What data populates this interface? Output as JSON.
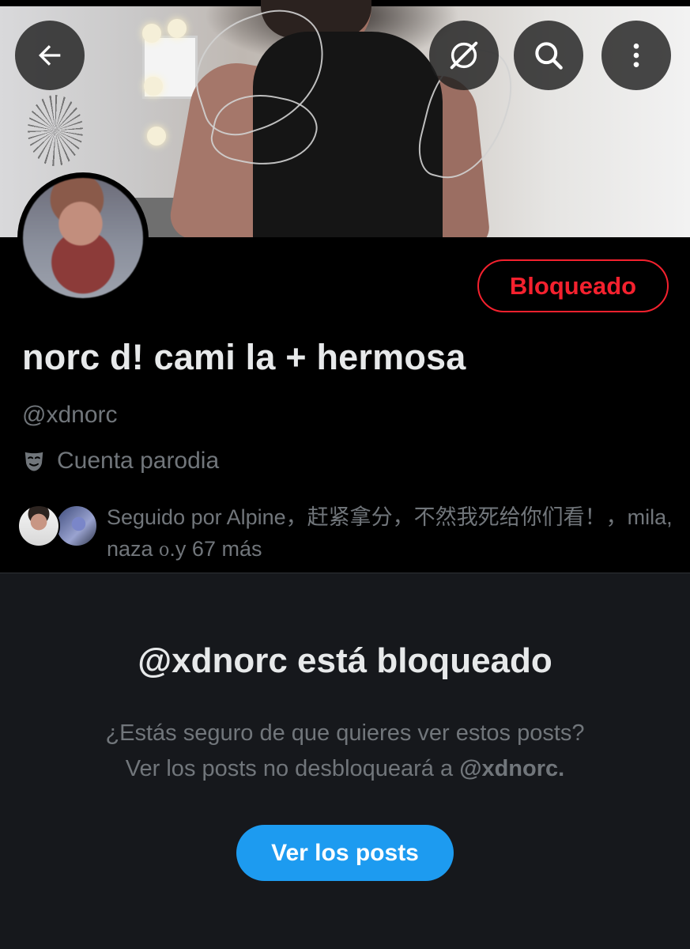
{
  "header": {
    "back_icon": "arrow-left-icon",
    "grok_icon": "grok-icon",
    "search_icon": "search-icon",
    "more_icon": "vertical-ellipsis-icon"
  },
  "profile": {
    "display_name": "norc d! cami la + hermosa",
    "handle": "@xdnorc",
    "parody_label": "Cuenta parodia",
    "parody_icon": "theater-mask-icon",
    "blocked_button_label": "Bloqueado",
    "followers_text": "Seguido por Alpine，赶紧拿分，不然我死给你们看！，mila, naza ᦞ.y 67 más"
  },
  "blocked_notice": {
    "title": "@xdnorc está bloqueado",
    "line1": "¿Estás seguro de que quieres ver estos posts?",
    "line2_prefix": "Ver los posts no desbloqueará a ",
    "line2_handle": "@xdnorc.",
    "button_label": "Ver los posts"
  },
  "colors": {
    "blocked_red": "#f4212e",
    "accent_blue": "#1d9bf0",
    "secondary_text": "#71767b",
    "primary_text": "#e7e9ea",
    "section_bg": "#16181c"
  }
}
